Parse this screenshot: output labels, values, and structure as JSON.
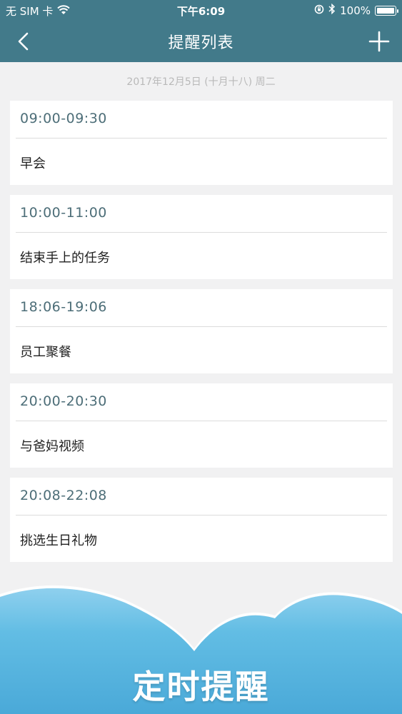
{
  "status_bar": {
    "carrier": "无 SIM 卡",
    "time": "下午6:09",
    "battery": "100%"
  },
  "nav": {
    "title": "提醒列表"
  },
  "date_header": "2017年12月5日 (十月十八) 周二",
  "reminders": [
    {
      "time_range": "09:00-09:30",
      "title": "早会"
    },
    {
      "time_range": "10:00-11:00",
      "title": "结束手上的任务"
    },
    {
      "time_range": "18:06-19:06",
      "title": "员工聚餐"
    },
    {
      "time_range": "20:00-20:30",
      "title": "与爸妈视频"
    },
    {
      "time_range": "20:08-22:08",
      "title": "挑选生日礼物"
    }
  ],
  "footer": {
    "slogan": "定时提醒"
  },
  "colors": {
    "header": "#427a8a",
    "background": "#f1f1f2",
    "cloud": "#5bb8df",
    "time_text": "#4d6e78"
  }
}
